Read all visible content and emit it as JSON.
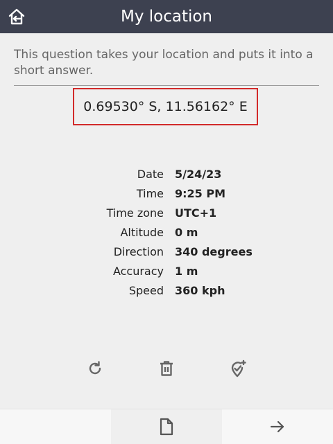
{
  "header": {
    "title": "My location",
    "home_icon": "home-back-icon"
  },
  "question": {
    "hint": "This question takes your location and puts it into a short answer."
  },
  "location": {
    "coordinates": "0.69530° S, 11.56162° E",
    "highlight_color": "#d22a2a"
  },
  "details": [
    {
      "label": "Date",
      "value": "5/24/23"
    },
    {
      "label": "Time",
      "value": "9:25 PM"
    },
    {
      "label": "Time zone",
      "value": "UTC+1"
    },
    {
      "label": "Altitude",
      "value": "0 m"
    },
    {
      "label": "Direction",
      "value": "340 degrees"
    },
    {
      "label": "Accuracy",
      "value": "1 m"
    },
    {
      "label": "Speed",
      "value": "360 kph"
    }
  ],
  "actions": {
    "refresh_icon": "refresh-icon",
    "delete_icon": "delete-icon",
    "pick_location_icon": "location-pick-icon"
  },
  "bottom_nav": {
    "document_icon": "document-icon",
    "next_icon": "arrow-right-icon"
  },
  "colors": {
    "header_bg": "#3d4150",
    "background": "#efefef"
  }
}
